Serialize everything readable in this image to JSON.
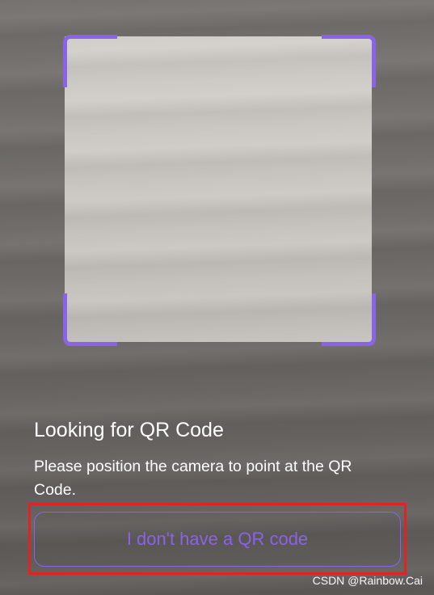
{
  "scanner": {
    "title": "Looking for QR Code",
    "description": "Please position the camera to point at the QR Code.",
    "no_qr_button_label": "I don't have a QR code"
  },
  "watermark": "CSDN @Rainbow.Cai",
  "colors": {
    "accent": "#8a63e8",
    "highlight_border": "#e02424",
    "text": "#ffffff"
  }
}
